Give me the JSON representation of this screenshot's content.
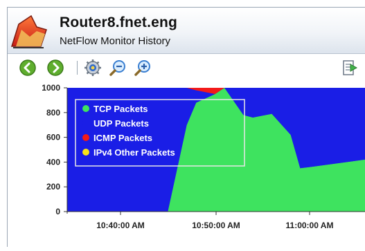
{
  "window": {
    "title": "Router8.fnet.eng",
    "subtitle": "NetFlow Monitor History",
    "app_icon": "chart-app-icon"
  },
  "toolbar": {
    "buttons": [
      {
        "name": "back-button",
        "icon": "green-left-arrow-icon"
      },
      {
        "name": "forward-button",
        "icon": "green-right-arrow-icon"
      },
      {
        "name": "settings-button",
        "icon": "gear-icon"
      },
      {
        "name": "zoom-out-button",
        "icon": "zoom-out-icon"
      },
      {
        "name": "zoom-in-button",
        "icon": "zoom-in-icon"
      },
      {
        "name": "export-button",
        "icon": "export-arrow-icon"
      }
    ]
  },
  "colors": {
    "tcp": "#3ee35f",
    "udp": "#1a1ee6",
    "icmp": "#f31a1a",
    "other": "#f7e31a",
    "legend_border": "#e7e7e7"
  },
  "chart_data": {
    "type": "area",
    "stacked": true,
    "ylim": [
      0,
      1000
    ],
    "y_ticks": [
      "1000",
      "800",
      "600",
      "400",
      "200",
      "0"
    ],
    "x_ticks": [
      "10:40:00 AM",
      "10:50:00 AM",
      "11:00:00 AM"
    ],
    "x": [
      "10:32",
      "10:39",
      "10:45",
      "10:47",
      "10:48",
      "10:50",
      "10:51",
      "10:53",
      "10:54",
      "10:56",
      "10:58",
      "10:59",
      "11:00",
      "11:01"
    ],
    "series": [
      {
        "name": "TCP Packets",
        "values": [
          0,
          0,
          0,
          700,
          880,
          950,
          1100,
          780,
          760,
          790,
          620,
          350,
          360,
          420
        ]
      },
      {
        "name": "UDP Packets",
        "values": [
          1100,
          1100,
          1100,
          400,
          100,
          0,
          0,
          320,
          340,
          310,
          480,
          750,
          740,
          680
        ]
      },
      {
        "name": "ICMP Packets",
        "values": [
          0,
          0,
          0,
          0,
          120,
          150,
          0,
          0,
          0,
          0,
          0,
          0,
          0,
          0
        ]
      },
      {
        "name": "IPv4 Other Packets",
        "values": [
          0,
          0,
          0,
          0,
          0,
          0,
          0,
          0,
          0,
          0,
          0,
          0,
          0,
          0
        ]
      }
    ],
    "legend": [
      "TCP Packets",
      "UDP Packets",
      "ICMP Packets",
      "IPv4 Other Packets"
    ],
    "legend_placement": "top-left",
    "grid": false
  }
}
